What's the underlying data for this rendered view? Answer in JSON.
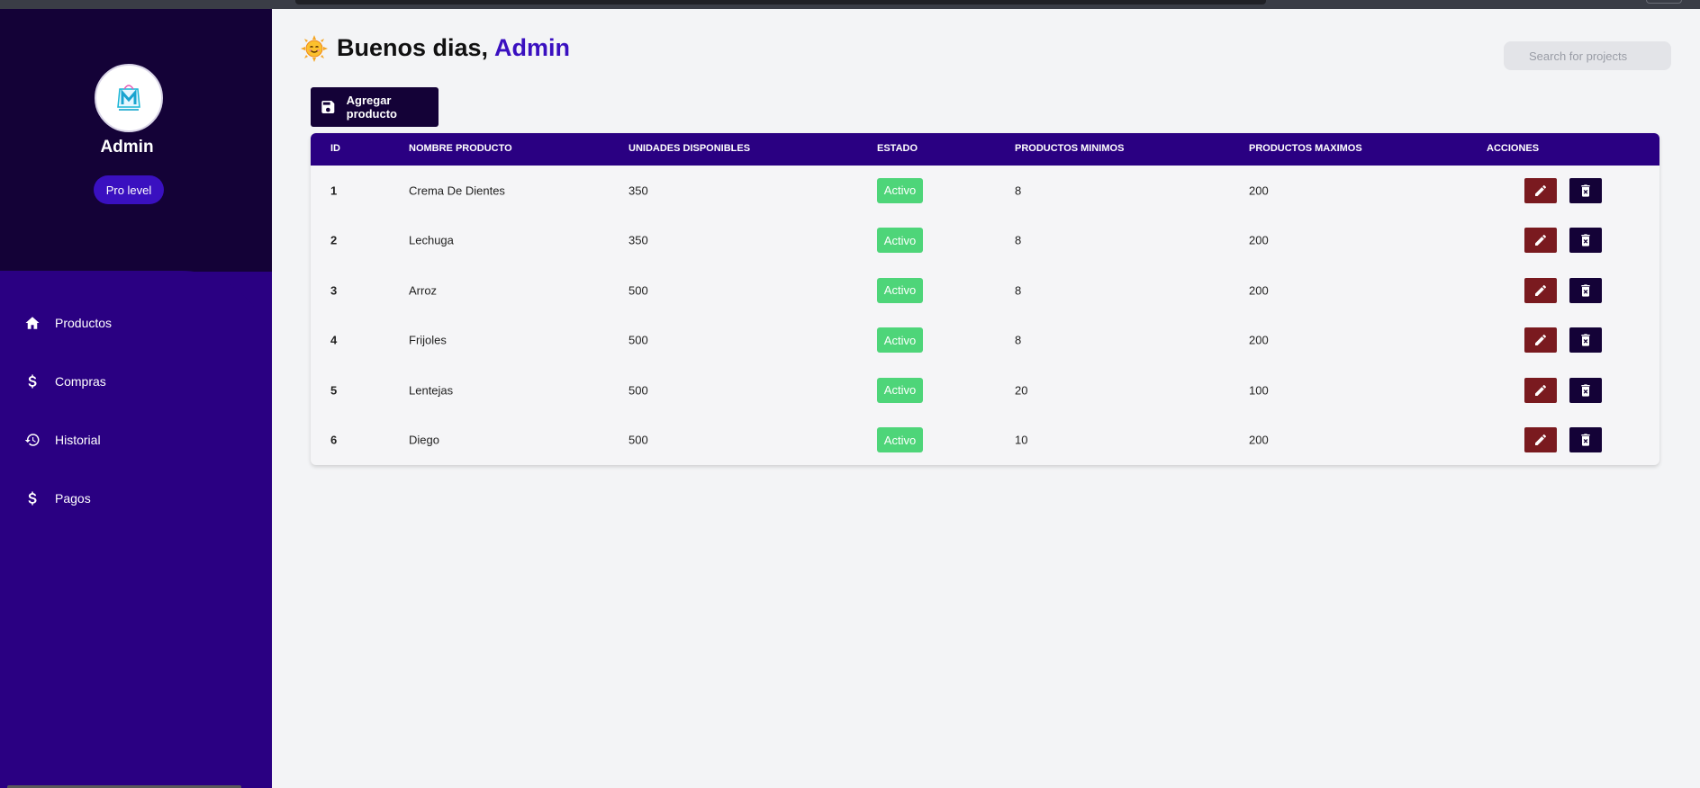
{
  "sidebar": {
    "user_name": "Admin",
    "badge": "Pro level",
    "items": [
      {
        "label": "Productos",
        "icon": "home-icon"
      },
      {
        "label": "Compras",
        "icon": "dollar-icon"
      },
      {
        "label": "Historial",
        "icon": "history-icon"
      },
      {
        "label": "Pagos",
        "icon": "dollar-icon"
      }
    ]
  },
  "header": {
    "greeting": "Buenos dias,",
    "name": "Admin",
    "search_placeholder": "Search for projects"
  },
  "toolbar": {
    "add_label": "Agregar producto"
  },
  "table": {
    "columns": [
      "ID",
      "NOMBRE PRODUCTO",
      "UNIDADES DISPONIBLES",
      "ESTADO",
      "PRODUCTOS MINIMOS",
      "PRODUCTOS MAXIMOS",
      "ACCIONES"
    ],
    "rows": [
      {
        "id": "1",
        "name": "Crema De Dientes",
        "units": "350",
        "state": "Activo",
        "min": "8",
        "max": "200"
      },
      {
        "id": "2",
        "name": "Lechuga",
        "units": "350",
        "state": "Activo",
        "min": "8",
        "max": "200"
      },
      {
        "id": "3",
        "name": "Arroz",
        "units": "500",
        "state": "Activo",
        "min": "8",
        "max": "200"
      },
      {
        "id": "4",
        "name": "Frijoles",
        "units": "500",
        "state": "Activo",
        "min": "8",
        "max": "200"
      },
      {
        "id": "5",
        "name": "Lentejas",
        "units": "500",
        "state": "Activo",
        "min": "20",
        "max": "100"
      },
      {
        "id": "6",
        "name": "Diego",
        "units": "500",
        "state": "Activo",
        "min": "10",
        "max": "200"
      }
    ]
  },
  "colors": {
    "sidebar_dark": "#140237",
    "sidebar_purple": "#2a0082",
    "accent": "#3a10c0",
    "active_badge": "#4ed579",
    "edit_button": "#7a1a1f"
  }
}
